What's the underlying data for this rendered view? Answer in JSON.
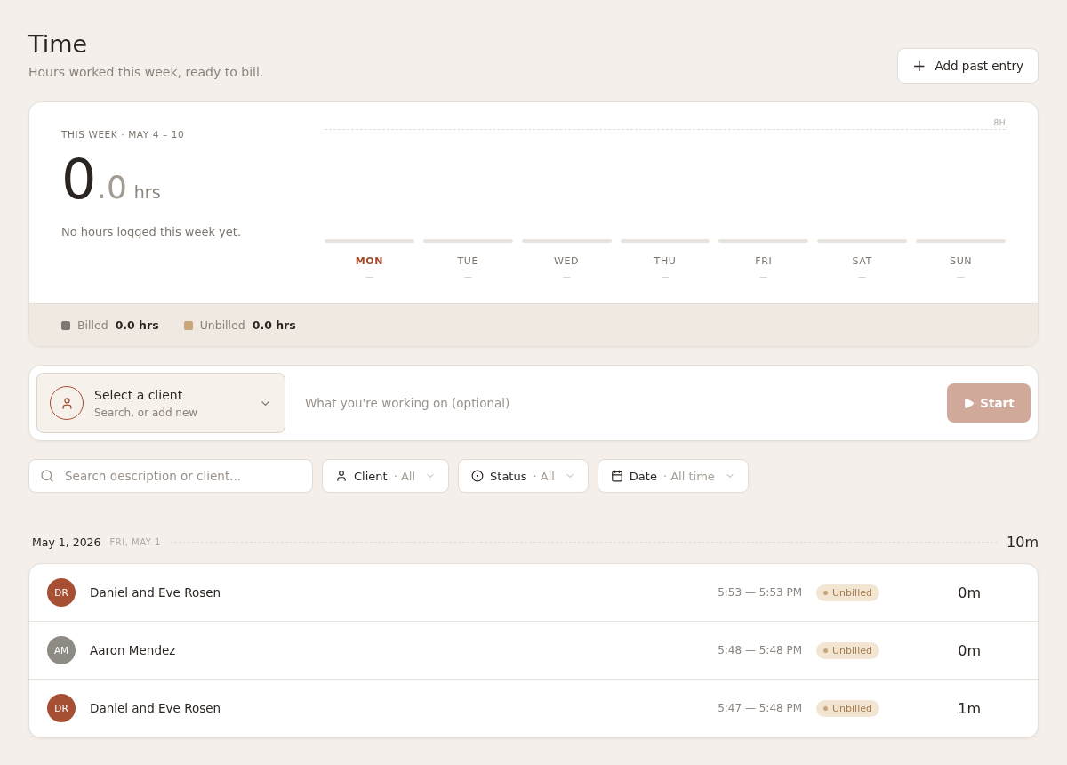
{
  "header": {
    "title": "Time",
    "subtitle": "Hours worked this week, ready to bill.",
    "add_button": {
      "icon": "+",
      "label": "Add past entry"
    }
  },
  "summary": {
    "range_label": "THIS WEEK · MAY 4 – 10",
    "hours_whole": "0",
    "hours_fraction": ".0",
    "unit": "hrs",
    "note": "No hours logged this week yet.",
    "scale_label": "8H",
    "days": [
      {
        "label": "MON",
        "value": "—",
        "selected": true
      },
      {
        "label": "TUE",
        "value": "—",
        "selected": false
      },
      {
        "label": "WED",
        "value": "—",
        "selected": false
      },
      {
        "label": "THU",
        "value": "—",
        "selected": false
      },
      {
        "label": "FRI",
        "value": "—",
        "selected": false
      },
      {
        "label": "SAT",
        "value": "—",
        "selected": false
      },
      {
        "label": "SUN",
        "value": "—",
        "selected": false
      }
    ],
    "legend": [
      {
        "label": "Billed",
        "value": "0.0 hrs",
        "color": "#7d7873"
      },
      {
        "label": "Unbilled",
        "value": "0.0 hrs",
        "color": "#c9a679"
      }
    ]
  },
  "timer": {
    "client_title": "Select a client",
    "client_hint": "Search, or add new",
    "description_placeholder": "What you're working on (optional)",
    "start_label": "Start"
  },
  "filters": {
    "search_placeholder": "Search description or client...",
    "dropdowns": [
      {
        "kind": "client",
        "label": "Client",
        "value": "· All"
      },
      {
        "kind": "status",
        "label": "Status",
        "value": "· All"
      },
      {
        "kind": "date",
        "label": "Date",
        "value": "· All time"
      }
    ]
  },
  "day_group": {
    "date": "May 1, 2026",
    "weekday": "FRI, MAY 1",
    "total": "10m",
    "entries": [
      {
        "initials": "DR",
        "color": "#a64f32",
        "client": "Daniel and Eve Rosen",
        "time_range": "5:53 — 5:53 PM",
        "status": "Unbilled",
        "duration": "0m"
      },
      {
        "initials": "AM",
        "color": "#8e8a84",
        "client": "Aaron Mendez",
        "time_range": "5:48 — 5:48 PM",
        "status": "Unbilled",
        "duration": "0m"
      },
      {
        "initials": "DR",
        "color": "#a64f32",
        "client": "Daniel and Eve Rosen",
        "time_range": "5:47 — 5:48 PM",
        "status": "Unbilled",
        "duration": "1m"
      }
    ]
  }
}
